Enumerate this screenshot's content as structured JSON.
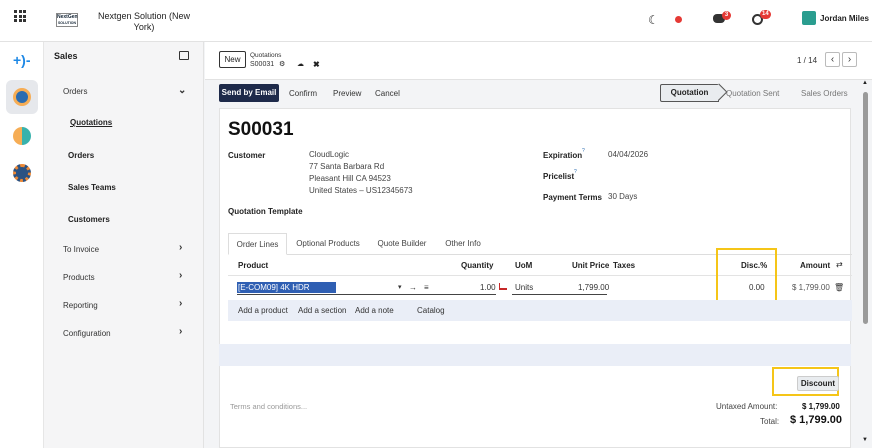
{
  "topbar": {
    "company": "Nextgen Solution (New York)",
    "logo_text": "NextGen SOLUTION",
    "chat_badge": "3",
    "activity_badge": "14",
    "user_name": "Jordan Miles"
  },
  "sidebar": {
    "title": "Sales",
    "items": [
      {
        "label": "Orders"
      },
      {
        "label": "Quotations"
      },
      {
        "label": "Orders"
      },
      {
        "label": "Sales Teams"
      },
      {
        "label": "Customers"
      },
      {
        "label": "To Invoice"
      },
      {
        "label": "Products"
      },
      {
        "label": "Reporting"
      },
      {
        "label": "Configuration"
      }
    ]
  },
  "control": {
    "new_label": "New",
    "breadcrumb": "Quotations",
    "record": "S00031",
    "pager": "1 / 14"
  },
  "actions": {
    "send_email": "Send by Email",
    "confirm": "Confirm",
    "preview": "Preview",
    "cancel": "Cancel"
  },
  "statusbar": {
    "steps": [
      "Quotation",
      "Quotation Sent",
      "Sales Orders"
    ],
    "active": "Quotation"
  },
  "form": {
    "title": "S00031",
    "customer_label": "Customer",
    "customer_name": "CloudLogic",
    "customer_addr1": "77 Santa Barbara Rd",
    "customer_addr2": "Pleasant Hill CA 94523",
    "customer_addr3": "United States – US12345673",
    "template_label": "Quotation Template",
    "expiration_label": "Expiration",
    "expiration_value": "04/04/2026",
    "pricelist_label": "Pricelist",
    "payment_label": "Payment Terms",
    "payment_value": "30 Days",
    "help_mark": "?"
  },
  "tabs": [
    "Order Lines",
    "Optional Products",
    "Quote Builder",
    "Other Info"
  ],
  "table": {
    "headers": {
      "product": "Product",
      "quantity": "Quantity",
      "uom": "UoM",
      "unit_price": "Unit Price",
      "taxes": "Taxes",
      "disc": "Disc.%",
      "amount": "Amount"
    },
    "row": {
      "product": "[E-COM09] 4K HDR Monitor",
      "quantity": "1.00",
      "uom": "Units",
      "unit_price": "1,799.00",
      "disc": "0.00",
      "amount": "$ 1,799.00"
    },
    "add_links": [
      "Add a product",
      "Add a section",
      "Add a note",
      "Catalog"
    ]
  },
  "footer": {
    "discount_btn": "Discount",
    "terms_placeholder": "Terms and conditions...",
    "untaxed_label": "Untaxed Amount:",
    "untaxed_value": "$ 1,799.00",
    "total_label": "Total:",
    "total_value": "$ 1,799.00"
  },
  "colors": {
    "primary": "#1e2a4a",
    "highlight": "#f5c518",
    "selection": "#2f5fb3",
    "badge": "#e53935"
  }
}
